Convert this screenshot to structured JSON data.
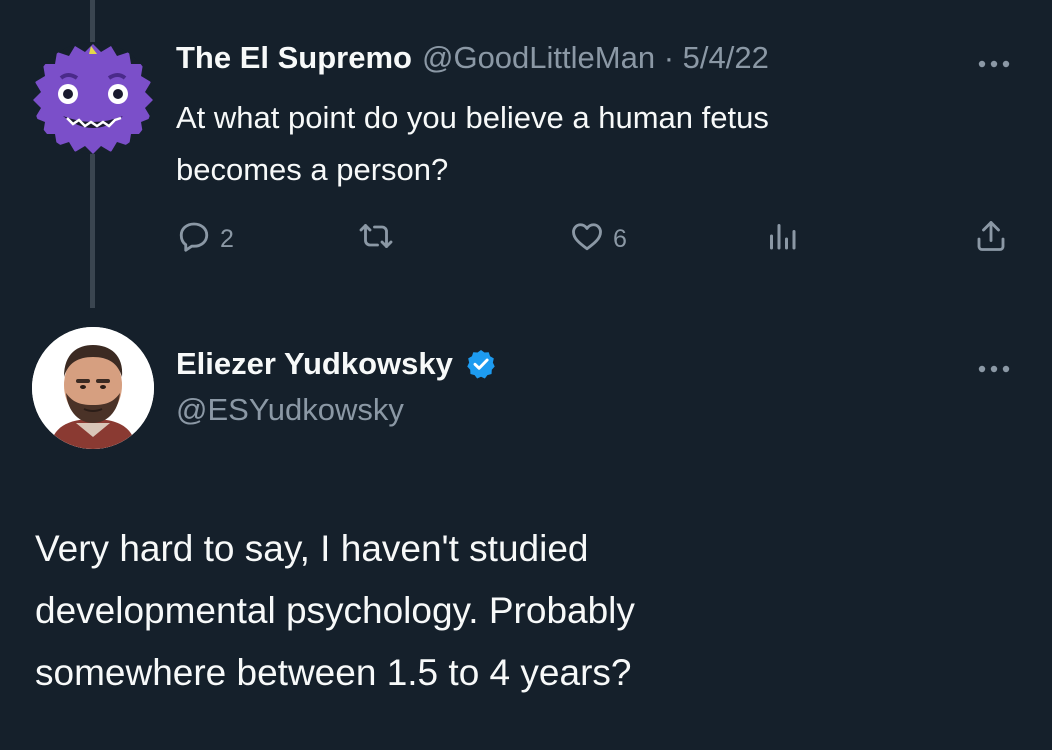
{
  "tweet1": {
    "display_name": "The El Supremo",
    "meta": "@GoodLittleMan · 5/4/22",
    "text_lines": [
      "At what point do you believe a human fetus",
      "becomes a person?"
    ],
    "actions": {
      "reply_count": "2",
      "like_count": "6"
    },
    "avatar": "purple-monster-avatar"
  },
  "tweet2": {
    "display_name": "Eliezer Yudkowsky",
    "handle": "@ESYudkowsky",
    "verified": true,
    "text_lines": [
      "Very hard to say, I haven't studied",
      "developmental psychology.  Probably",
      "somewhere between 1.5 to 4 years?"
    ],
    "avatar": "man-portrait-avatar"
  },
  "colors": {
    "background": "#15202b",
    "text": "#f7f9f9",
    "muted": "#8b98a5",
    "verified": "#1d9bf0",
    "avatar_purple": "#7b4fc9"
  },
  "icons": [
    "reply-icon",
    "retweet-icon",
    "like-icon",
    "views-icon",
    "share-icon",
    "more-icon",
    "verified-badge-icon"
  ]
}
